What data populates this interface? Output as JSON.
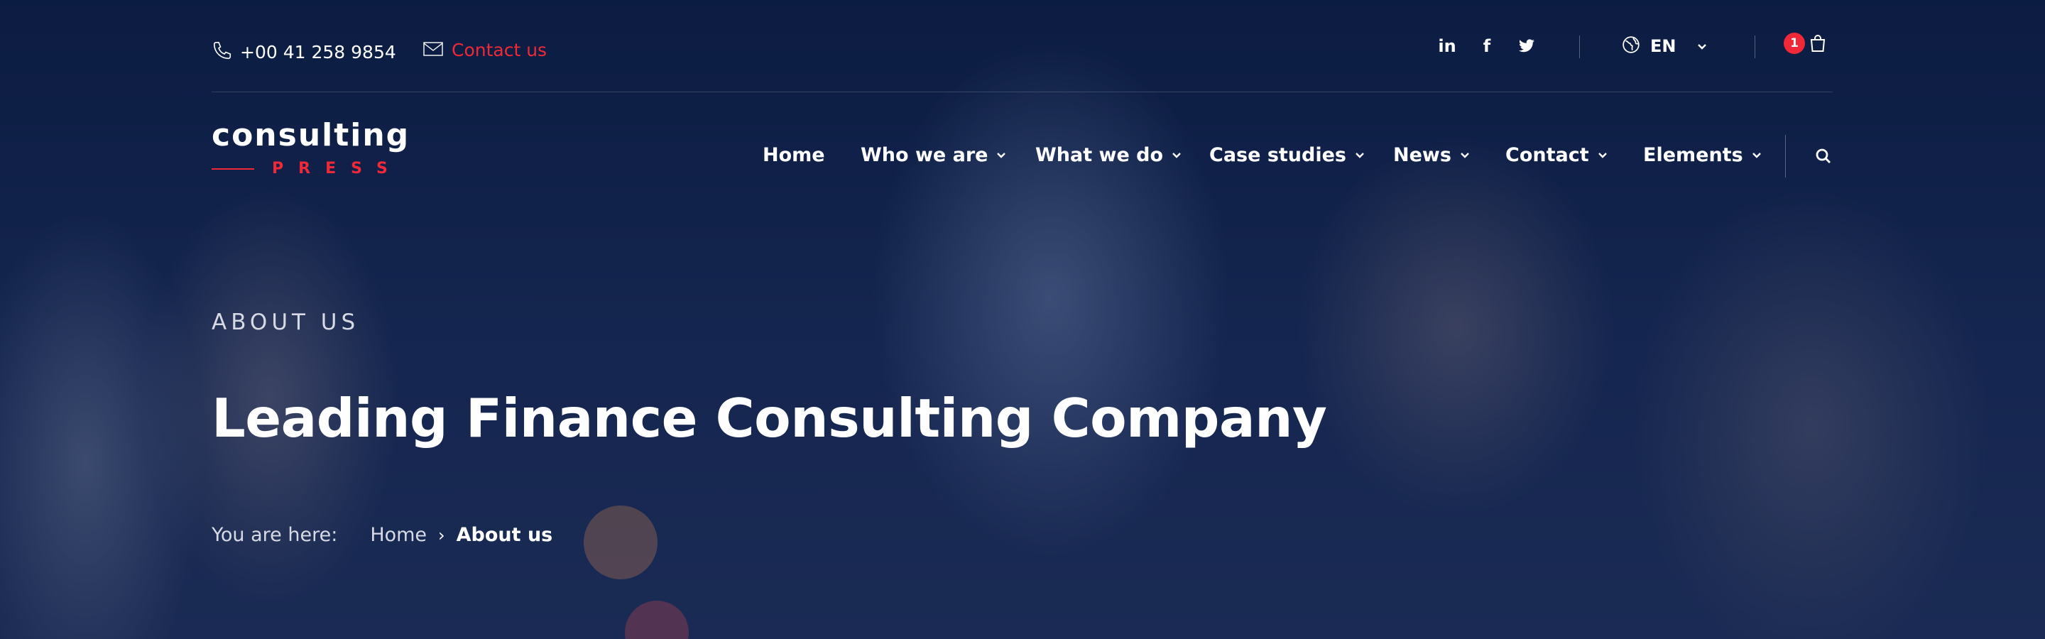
{
  "topbar": {
    "phone": "+00 41 258 9854",
    "contact_label": "Contact us",
    "social": [
      "linkedin-icon",
      "facebook-icon",
      "twitter-icon"
    ],
    "language": "EN",
    "cart_count": "1"
  },
  "logo": {
    "name": "consulting",
    "tagline": "PRESS"
  },
  "nav": {
    "items": [
      {
        "label": "Home",
        "has_dropdown": false
      },
      {
        "label": "Who we are",
        "has_dropdown": true
      },
      {
        "label": "What we do",
        "has_dropdown": true
      },
      {
        "label": "Case studies",
        "has_dropdown": true
      },
      {
        "label": "News",
        "has_dropdown": true
      },
      {
        "label": "Contact",
        "has_dropdown": true
      },
      {
        "label": "Elements",
        "has_dropdown": true
      }
    ]
  },
  "hero": {
    "eyebrow": "ABOUT US",
    "title": "Leading Finance Consulting Company"
  },
  "breadcrumb": {
    "label": "You are here:",
    "home": "Home",
    "separator": "›",
    "current": "About us"
  },
  "colors": {
    "accent": "#ef2938",
    "overlay": "#0e2146"
  }
}
